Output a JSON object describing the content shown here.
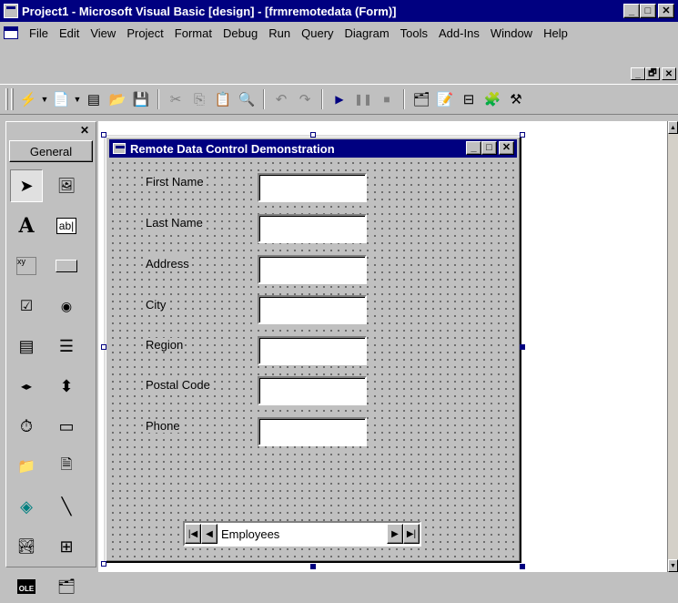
{
  "window": {
    "title": "Project1 - Microsoft Visual Basic [design] - [frmremotedata (Form)]",
    "minimize": "_",
    "maximize": "□",
    "close": "✕"
  },
  "menu": [
    {
      "label": "File"
    },
    {
      "label": "Edit"
    },
    {
      "label": "View"
    },
    {
      "label": "Project"
    },
    {
      "label": "Format"
    },
    {
      "label": "Debug"
    },
    {
      "label": "Run"
    },
    {
      "label": "Query"
    },
    {
      "label": "Diagram"
    },
    {
      "label": "Tools"
    },
    {
      "label": "Add-Ins"
    },
    {
      "label": "Window"
    },
    {
      "label": "Help"
    }
  ],
  "mdi_buttons": {
    "minimize": "_",
    "restore": "🗗",
    "close": "✕"
  },
  "toolbar": {
    "icons": [
      "add-project-icon",
      "add-form-icon",
      "menu-editor-icon",
      "open-icon",
      "save-icon",
      "cut-icon",
      "copy-icon",
      "paste-icon",
      "find-icon",
      "undo-icon",
      "redo-icon",
      "start-icon",
      "break-icon",
      "end-icon",
      "project-explorer-icon",
      "properties-window-icon",
      "form-layout-icon",
      "object-browser-icon",
      "toolbox-icon"
    ]
  },
  "toolbox": {
    "close": "✕",
    "tab_label": "General",
    "tools": [
      {
        "name": "pointer",
        "glyph": "➤"
      },
      {
        "name": "picturebox",
        "glyph": "🖼"
      },
      {
        "name": "label",
        "glyph": "A"
      },
      {
        "name": "textbox",
        "glyph": "ab|"
      },
      {
        "name": "frame",
        "glyph": "xy"
      },
      {
        "name": "commandbutton",
        "glyph": "▭"
      },
      {
        "name": "checkbox",
        "glyph": "☑"
      },
      {
        "name": "optionbutton",
        "glyph": "◉"
      },
      {
        "name": "combobox",
        "glyph": "▤"
      },
      {
        "name": "listbox",
        "glyph": "☰"
      },
      {
        "name": "hscrollbar",
        "glyph": "◂▸"
      },
      {
        "name": "vscrollbar",
        "glyph": "⬍"
      },
      {
        "name": "timer",
        "glyph": "⏱"
      },
      {
        "name": "drivelistbox",
        "glyph": "▭"
      },
      {
        "name": "dirlistbox",
        "glyph": "📁"
      },
      {
        "name": "filelistbox",
        "glyph": "🗎"
      },
      {
        "name": "shape",
        "glyph": "◈"
      },
      {
        "name": "line",
        "glyph": "╲"
      },
      {
        "name": "image",
        "glyph": "🏞"
      },
      {
        "name": "data",
        "glyph": "⊞"
      },
      {
        "name": "ole",
        "glyph": "OLE"
      },
      {
        "name": "remote-data",
        "glyph": "🗂"
      }
    ]
  },
  "form": {
    "title": "Remote Data Control Demonstration",
    "fields": [
      {
        "label": "First Name",
        "value": ""
      },
      {
        "label": "Last Name",
        "value": ""
      },
      {
        "label": "Address",
        "value": ""
      },
      {
        "label": "City",
        "value": ""
      },
      {
        "label": "Region",
        "value": ""
      },
      {
        "label": "Postal Code",
        "value": ""
      },
      {
        "label": "Phone",
        "value": ""
      }
    ],
    "data_control": {
      "caption": "Employees",
      "first": "|◀",
      "prev": "◀",
      "next": "▶",
      "last": "▶|"
    }
  }
}
